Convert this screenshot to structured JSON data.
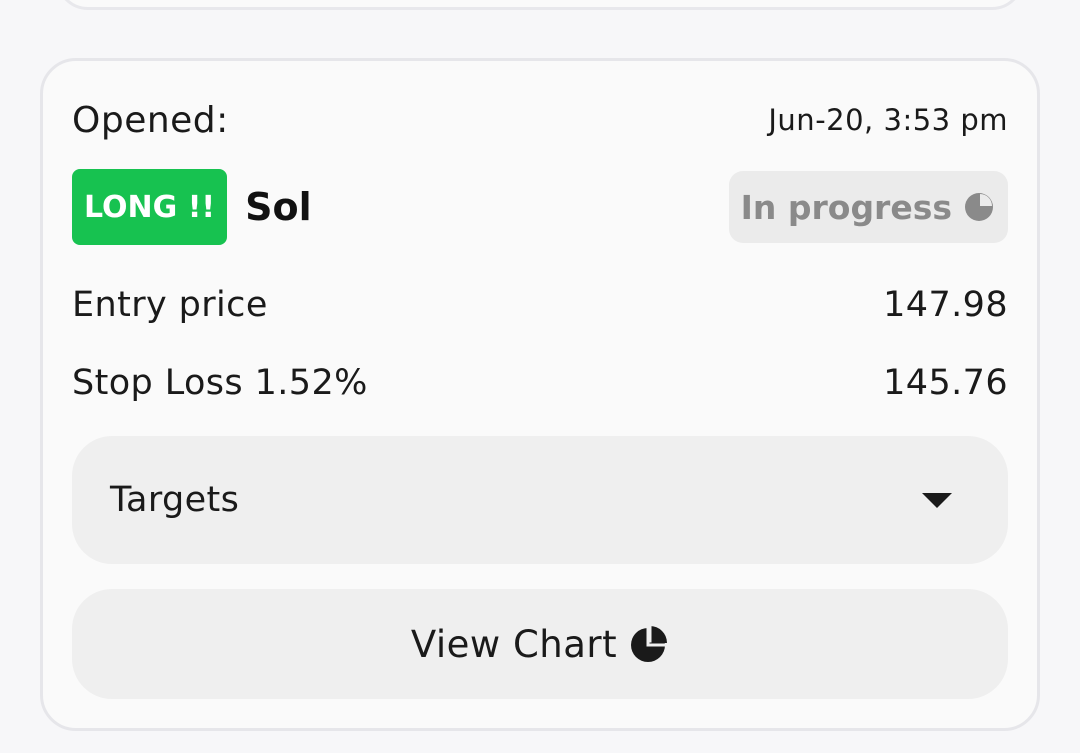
{
  "card": {
    "opened_label": "Opened:",
    "opened_date": "Jun-20, 3:53 pm",
    "direction_badge": "LONG !!",
    "pair": "Sol",
    "status": "In progress",
    "status_icon": "pie-progress-icon",
    "entry": {
      "label": "Entry price",
      "value": "147.98"
    },
    "stop_loss": {
      "label": "Stop Loss 1.52%",
      "value": "145.76"
    },
    "targets": {
      "label": "Targets",
      "icon": "caret-down-icon"
    },
    "view_chart": {
      "label": "View Chart",
      "icon": "pie-chart-icon"
    }
  },
  "colors": {
    "long_badge": "#17c250",
    "status_pill_bg": "#ebebeb",
    "status_text": "#8a8a8a",
    "button_bg": "#efefef",
    "card_bg": "#fafafa",
    "page_bg": "#f7f7f9"
  }
}
